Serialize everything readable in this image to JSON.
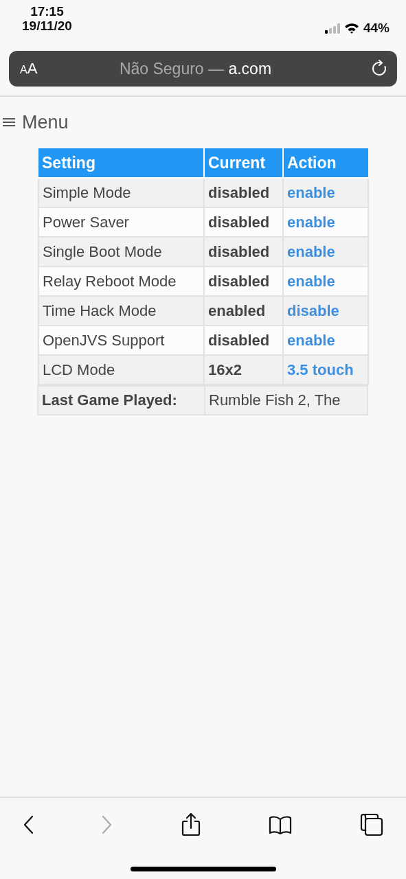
{
  "status_bar": {
    "time": "17:15",
    "date": "19/11/20",
    "battery": "44%"
  },
  "address_bar": {
    "text_size_button": "AA",
    "security_label": "Não Seguro — ",
    "domain": "a.com"
  },
  "menu": {
    "label": "Menu"
  },
  "table": {
    "columns": [
      "Setting",
      "Current",
      "Action"
    ],
    "rows": [
      {
        "setting": "Simple Mode",
        "current": "disabled",
        "action": "enable"
      },
      {
        "setting": "Power Saver",
        "current": "disabled",
        "action": "enable"
      },
      {
        "setting": "Single Boot Mode",
        "current": "disabled",
        "action": "enable"
      },
      {
        "setting": "Relay Reboot Mode",
        "current": "disabled",
        "action": "enable"
      },
      {
        "setting": "Time Hack Mode",
        "current": "enabled",
        "action": "disable"
      },
      {
        "setting": "OpenJVS Support",
        "current": "disabled",
        "action": "enable"
      },
      {
        "setting": "LCD Mode",
        "current": "16x2",
        "action": "3.5 touch"
      }
    ],
    "footer": {
      "label": "Last Game Played:",
      "value": "Rumble Fish 2, The"
    }
  },
  "toolbar": {
    "back_disabled": false,
    "forward_disabled": true
  }
}
